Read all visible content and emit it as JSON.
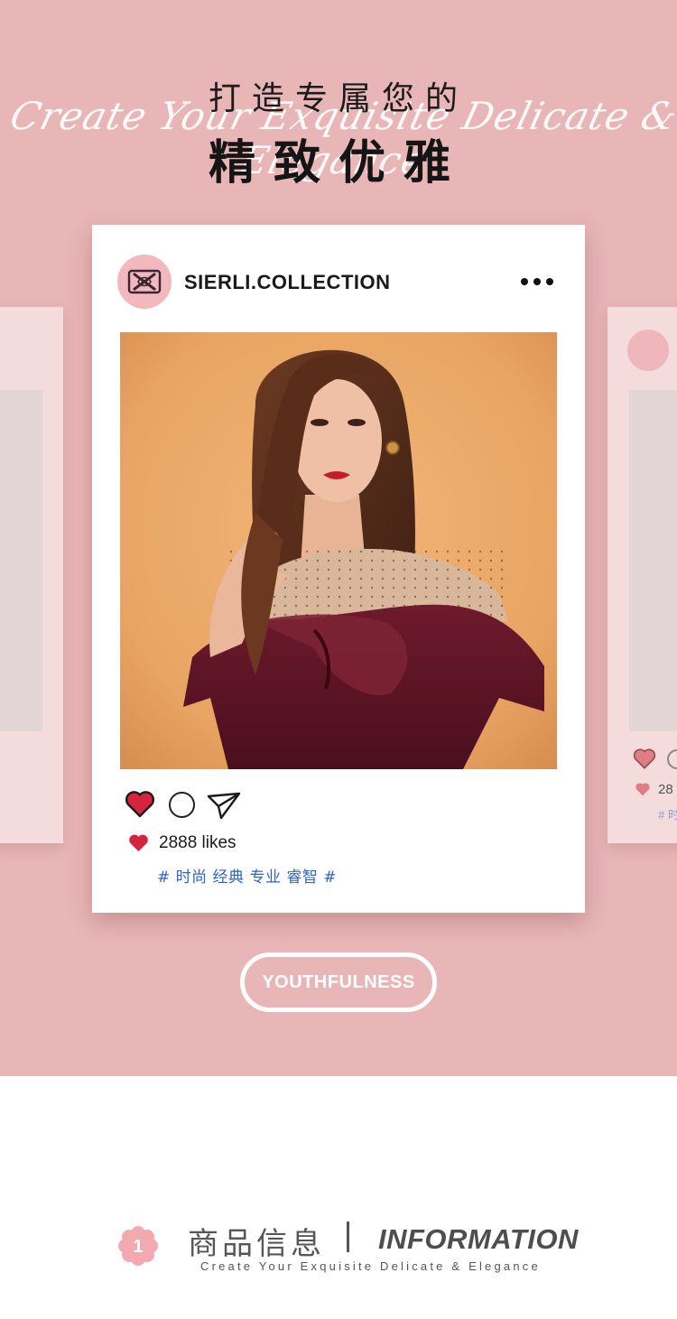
{
  "header": {
    "title_cn_line1": "打造专属您的",
    "title_script": "Create Your Exquisite Delicate & Elegance",
    "title_cn_line2": "精致优雅"
  },
  "post": {
    "username": "SIERLI.COLLECTION",
    "more_icon": "more-horizontal-icon",
    "avatar_icon": "sierli-logo",
    "likes": "2888 likes",
    "tags": "# 时尚 经典 专业 睿智 #",
    "like_color": "#d6243f",
    "tag_color": "#2f64c4"
  },
  "side_card": {
    "likes_partial": "28",
    "tags_partial": "# 时"
  },
  "button": {
    "label": "YOUTHFULNESS"
  },
  "info_section": {
    "number": "1",
    "title_cn": "商品信息",
    "title_en": "INFORMATION",
    "subtitle": "Create Your Exquisite Delicate & Elegance"
  },
  "colors": {
    "background_pink": "#e8b6b7",
    "card_white": "#ffffff",
    "accent_pink": "#f2b8be"
  }
}
